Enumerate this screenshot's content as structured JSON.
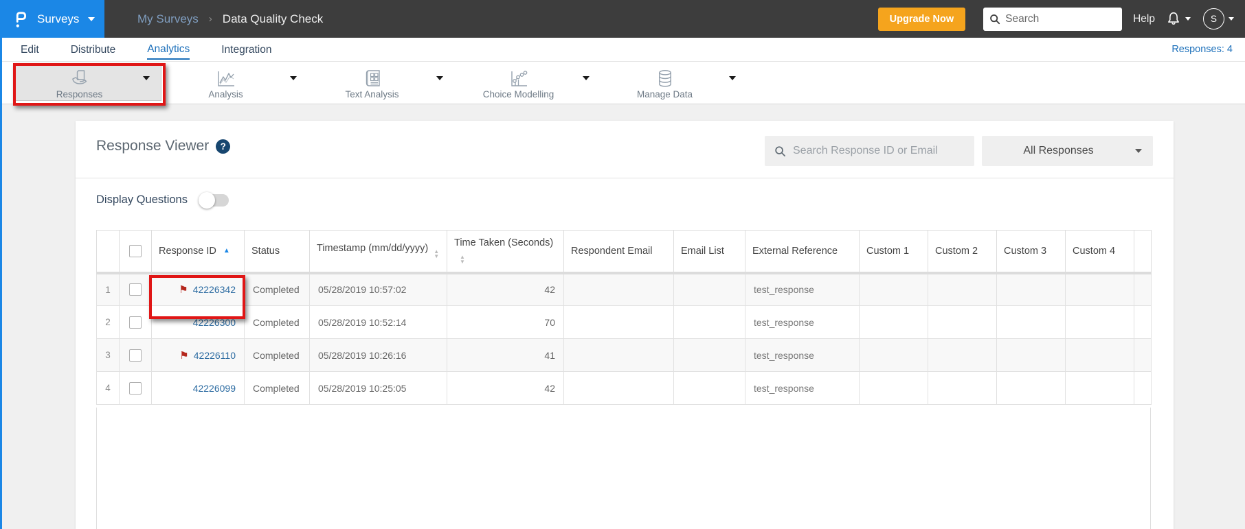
{
  "topbar": {
    "product": "Surveys",
    "breadcrumb": {
      "parent": "My Surveys",
      "separator": "›",
      "current": "Data Quality Check"
    },
    "upgrade_label": "Upgrade Now",
    "search_placeholder": "Search",
    "help_label": "Help",
    "avatar_initial": "S"
  },
  "tabs": {
    "items": [
      {
        "label": "Edit",
        "active": false
      },
      {
        "label": "Distribute",
        "active": false
      },
      {
        "label": "Analytics",
        "active": true
      },
      {
        "label": "Integration",
        "active": false
      }
    ],
    "responses_count": "Responses: 4"
  },
  "toolbar": {
    "items": [
      {
        "label": "Responses",
        "icon": "hand-holding-page-icon",
        "active": true,
        "annotated": true
      },
      {
        "label": "Analysis",
        "icon": "line-chart-icon",
        "active": false
      },
      {
        "label": "Text Analysis",
        "icon": "text-analysis-icon",
        "active": false
      },
      {
        "label": "Choice Modelling",
        "icon": "dotted-trend-icon",
        "active": false
      },
      {
        "label": "Manage Data",
        "icon": "database-icon",
        "active": false
      }
    ]
  },
  "panel": {
    "title": "Response Viewer",
    "help_glyph": "?",
    "search_placeholder": "Search Response ID or Email",
    "filter_value": "All Responses",
    "display_questions_label": "Display Questions",
    "display_questions_enabled": false
  },
  "table": {
    "columns": [
      {
        "label": "",
        "sort": null
      },
      {
        "label": "",
        "sort": null
      },
      {
        "label": "Response ID",
        "sort": "asc"
      },
      {
        "label": "Status",
        "sort": null
      },
      {
        "label": "Timestamp (mm/dd/yyyy)",
        "sort": "both"
      },
      {
        "label": "Time Taken (Seconds)",
        "sort": "both"
      },
      {
        "label": "Respondent Email",
        "sort": null
      },
      {
        "label": "Email List",
        "sort": null
      },
      {
        "label": "External Reference",
        "sort": null
      },
      {
        "label": "Custom 1",
        "sort": null
      },
      {
        "label": "Custom 2",
        "sort": null
      },
      {
        "label": "Custom 3",
        "sort": null
      },
      {
        "label": "Custom 4",
        "sort": null
      },
      {
        "label": "",
        "sort": null
      }
    ],
    "rows": [
      {
        "num": "1",
        "flagged": true,
        "annotated": true,
        "id": "42226342",
        "status": "Completed",
        "timestamp": "05/28/2019 10:57:02",
        "time_taken_seconds": "42",
        "respondent_email": "",
        "email_list": "",
        "external_reference": "test_response",
        "custom1": "",
        "custom2": "",
        "custom3": "",
        "custom4": ""
      },
      {
        "num": "2",
        "flagged": false,
        "annotated": false,
        "id": "42226300",
        "status": "Completed",
        "timestamp": "05/28/2019 10:52:14",
        "time_taken_seconds": "70",
        "respondent_email": "",
        "email_list": "",
        "external_reference": "test_response",
        "custom1": "",
        "custom2": "",
        "custom3": "",
        "custom4": ""
      },
      {
        "num": "3",
        "flagged": true,
        "annotated": false,
        "id": "42226110",
        "status": "Completed",
        "timestamp": "05/28/2019 10:26:16",
        "time_taken_seconds": "41",
        "respondent_email": "",
        "email_list": "",
        "external_reference": "test_response",
        "custom1": "",
        "custom2": "",
        "custom3": "",
        "custom4": ""
      },
      {
        "num": "4",
        "flagged": false,
        "annotated": false,
        "id": "42226099",
        "status": "Completed",
        "timestamp": "05/28/2019 10:25:05",
        "time_taken_seconds": "42",
        "respondent_email": "",
        "email_list": "",
        "external_reference": "test_response",
        "custom1": "",
        "custom2": "",
        "custom3": "",
        "custom4": ""
      }
    ]
  },
  "glyphs": {
    "flag": "⚑",
    "sort_asc": "▲",
    "sort_up": "▲",
    "sort_down": "▼"
  },
  "colors": {
    "topbar_blue": "#1b87e6",
    "dark_bar": "#3d3d3d",
    "accent_orange": "#f5a41d",
    "active_tab_blue": "#1b6fba",
    "link_blue": "#2d6ca2",
    "flag_red": "#b5271d",
    "annotation_red": "#e01616"
  },
  "annotations": {
    "highlighted_elements": [
      "responses-toolbar-button",
      "response-id-42226342-cell"
    ]
  }
}
